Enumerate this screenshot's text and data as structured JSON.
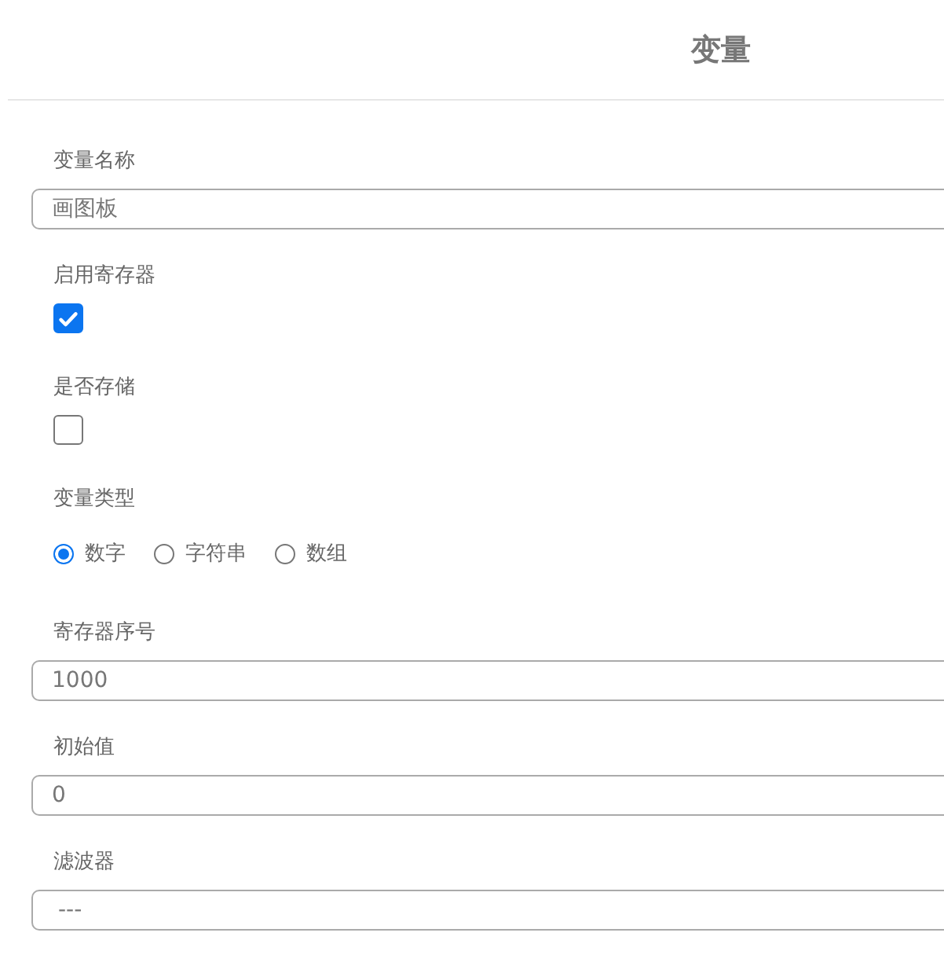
{
  "title": "变量",
  "fields": [
    {
      "kind": "text",
      "label": "变量名称",
      "value": "画图板"
    },
    {
      "kind": "checkbox",
      "label": "启用寄存器",
      "checked": true
    },
    {
      "kind": "checkbox",
      "label": "是否存储",
      "checked": false
    },
    {
      "kind": "radio",
      "label": "变量类型",
      "options": [
        {
          "label": "数字",
          "selected": true
        },
        {
          "label": "字符串",
          "selected": false
        },
        {
          "label": "数组",
          "selected": false
        }
      ]
    },
    {
      "kind": "text",
      "label": "寄存器序号",
      "value": "1000"
    },
    {
      "kind": "text",
      "label": "初始值",
      "value": "0"
    },
    {
      "kind": "select",
      "label": "滤波器",
      "value": "---"
    }
  ]
}
